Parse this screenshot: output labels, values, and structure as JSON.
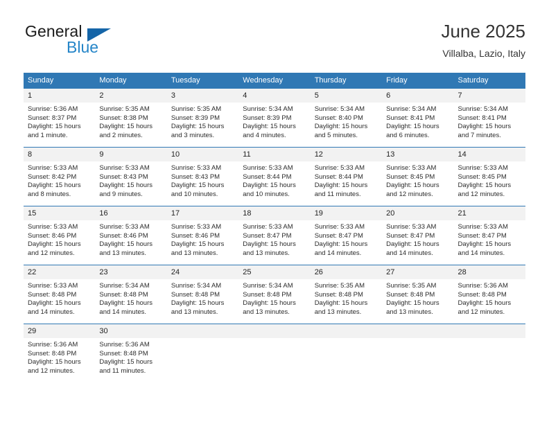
{
  "brand": {
    "name_top": "General",
    "name_bottom": "Blue",
    "accent_color": "#2585c8",
    "triangle_color": "#1565a8"
  },
  "header": {
    "title": "June 2025",
    "subtitle": "Villalba, Lazio, Italy"
  },
  "calendar": {
    "header_bg": "#3078b4",
    "daynum_bg": "#f2f2f2",
    "weekday_headers": [
      "Sunday",
      "Monday",
      "Tuesday",
      "Wednesday",
      "Thursday",
      "Friday",
      "Saturday"
    ],
    "labels": {
      "sunrise": "Sunrise:",
      "sunset": "Sunset:",
      "daylight": "Daylight:"
    },
    "weeks": [
      [
        {
          "day": "1",
          "sunrise": "Sunrise: 5:36 AM",
          "sunset": "Sunset: 8:37 PM",
          "daylight_line1": "Daylight: 15 hours",
          "daylight_line2": "and 1 minute."
        },
        {
          "day": "2",
          "sunrise": "Sunrise: 5:35 AM",
          "sunset": "Sunset: 8:38 PM",
          "daylight_line1": "Daylight: 15 hours",
          "daylight_line2": "and 2 minutes."
        },
        {
          "day": "3",
          "sunrise": "Sunrise: 5:35 AM",
          "sunset": "Sunset: 8:39 PM",
          "daylight_line1": "Daylight: 15 hours",
          "daylight_line2": "and 3 minutes."
        },
        {
          "day": "4",
          "sunrise": "Sunrise: 5:34 AM",
          "sunset": "Sunset: 8:39 PM",
          "daylight_line1": "Daylight: 15 hours",
          "daylight_line2": "and 4 minutes."
        },
        {
          "day": "5",
          "sunrise": "Sunrise: 5:34 AM",
          "sunset": "Sunset: 8:40 PM",
          "daylight_line1": "Daylight: 15 hours",
          "daylight_line2": "and 5 minutes."
        },
        {
          "day": "6",
          "sunrise": "Sunrise: 5:34 AM",
          "sunset": "Sunset: 8:41 PM",
          "daylight_line1": "Daylight: 15 hours",
          "daylight_line2": "and 6 minutes."
        },
        {
          "day": "7",
          "sunrise": "Sunrise: 5:34 AM",
          "sunset": "Sunset: 8:41 PM",
          "daylight_line1": "Daylight: 15 hours",
          "daylight_line2": "and 7 minutes."
        }
      ],
      [
        {
          "day": "8",
          "sunrise": "Sunrise: 5:33 AM",
          "sunset": "Sunset: 8:42 PM",
          "daylight_line1": "Daylight: 15 hours",
          "daylight_line2": "and 8 minutes."
        },
        {
          "day": "9",
          "sunrise": "Sunrise: 5:33 AM",
          "sunset": "Sunset: 8:43 PM",
          "daylight_line1": "Daylight: 15 hours",
          "daylight_line2": "and 9 minutes."
        },
        {
          "day": "10",
          "sunrise": "Sunrise: 5:33 AM",
          "sunset": "Sunset: 8:43 PM",
          "daylight_line1": "Daylight: 15 hours",
          "daylight_line2": "and 10 minutes."
        },
        {
          "day": "11",
          "sunrise": "Sunrise: 5:33 AM",
          "sunset": "Sunset: 8:44 PM",
          "daylight_line1": "Daylight: 15 hours",
          "daylight_line2": "and 10 minutes."
        },
        {
          "day": "12",
          "sunrise": "Sunrise: 5:33 AM",
          "sunset": "Sunset: 8:44 PM",
          "daylight_line1": "Daylight: 15 hours",
          "daylight_line2": "and 11 minutes."
        },
        {
          "day": "13",
          "sunrise": "Sunrise: 5:33 AM",
          "sunset": "Sunset: 8:45 PM",
          "daylight_line1": "Daylight: 15 hours",
          "daylight_line2": "and 12 minutes."
        },
        {
          "day": "14",
          "sunrise": "Sunrise: 5:33 AM",
          "sunset": "Sunset: 8:45 PM",
          "daylight_line1": "Daylight: 15 hours",
          "daylight_line2": "and 12 minutes."
        }
      ],
      [
        {
          "day": "15",
          "sunrise": "Sunrise: 5:33 AM",
          "sunset": "Sunset: 8:46 PM",
          "daylight_line1": "Daylight: 15 hours",
          "daylight_line2": "and 12 minutes."
        },
        {
          "day": "16",
          "sunrise": "Sunrise: 5:33 AM",
          "sunset": "Sunset: 8:46 PM",
          "daylight_line1": "Daylight: 15 hours",
          "daylight_line2": "and 13 minutes."
        },
        {
          "day": "17",
          "sunrise": "Sunrise: 5:33 AM",
          "sunset": "Sunset: 8:46 PM",
          "daylight_line1": "Daylight: 15 hours",
          "daylight_line2": "and 13 minutes."
        },
        {
          "day": "18",
          "sunrise": "Sunrise: 5:33 AM",
          "sunset": "Sunset: 8:47 PM",
          "daylight_line1": "Daylight: 15 hours",
          "daylight_line2": "and 13 minutes."
        },
        {
          "day": "19",
          "sunrise": "Sunrise: 5:33 AM",
          "sunset": "Sunset: 8:47 PM",
          "daylight_line1": "Daylight: 15 hours",
          "daylight_line2": "and 14 minutes."
        },
        {
          "day": "20",
          "sunrise": "Sunrise: 5:33 AM",
          "sunset": "Sunset: 8:47 PM",
          "daylight_line1": "Daylight: 15 hours",
          "daylight_line2": "and 14 minutes."
        },
        {
          "day": "21",
          "sunrise": "Sunrise: 5:33 AM",
          "sunset": "Sunset: 8:47 PM",
          "daylight_line1": "Daylight: 15 hours",
          "daylight_line2": "and 14 minutes."
        }
      ],
      [
        {
          "day": "22",
          "sunrise": "Sunrise: 5:33 AM",
          "sunset": "Sunset: 8:48 PM",
          "daylight_line1": "Daylight: 15 hours",
          "daylight_line2": "and 14 minutes."
        },
        {
          "day": "23",
          "sunrise": "Sunrise: 5:34 AM",
          "sunset": "Sunset: 8:48 PM",
          "daylight_line1": "Daylight: 15 hours",
          "daylight_line2": "and 14 minutes."
        },
        {
          "day": "24",
          "sunrise": "Sunrise: 5:34 AM",
          "sunset": "Sunset: 8:48 PM",
          "daylight_line1": "Daylight: 15 hours",
          "daylight_line2": "and 13 minutes."
        },
        {
          "day": "25",
          "sunrise": "Sunrise: 5:34 AM",
          "sunset": "Sunset: 8:48 PM",
          "daylight_line1": "Daylight: 15 hours",
          "daylight_line2": "and 13 minutes."
        },
        {
          "day": "26",
          "sunrise": "Sunrise: 5:35 AM",
          "sunset": "Sunset: 8:48 PM",
          "daylight_line1": "Daylight: 15 hours",
          "daylight_line2": "and 13 minutes."
        },
        {
          "day": "27",
          "sunrise": "Sunrise: 5:35 AM",
          "sunset": "Sunset: 8:48 PM",
          "daylight_line1": "Daylight: 15 hours",
          "daylight_line2": "and 13 minutes."
        },
        {
          "day": "28",
          "sunrise": "Sunrise: 5:36 AM",
          "sunset": "Sunset: 8:48 PM",
          "daylight_line1": "Daylight: 15 hours",
          "daylight_line2": "and 12 minutes."
        }
      ],
      [
        {
          "day": "29",
          "sunrise": "Sunrise: 5:36 AM",
          "sunset": "Sunset: 8:48 PM",
          "daylight_line1": "Daylight: 15 hours",
          "daylight_line2": "and 12 minutes."
        },
        {
          "day": "30",
          "sunrise": "Sunrise: 5:36 AM",
          "sunset": "Sunset: 8:48 PM",
          "daylight_line1": "Daylight: 15 hours",
          "daylight_line2": "and 11 minutes."
        },
        {
          "day": "",
          "sunrise": "",
          "sunset": "",
          "daylight_line1": "",
          "daylight_line2": "",
          "empty": true
        },
        {
          "day": "",
          "sunrise": "",
          "sunset": "",
          "daylight_line1": "",
          "daylight_line2": "",
          "empty": true
        },
        {
          "day": "",
          "sunrise": "",
          "sunset": "",
          "daylight_line1": "",
          "daylight_line2": "",
          "empty": true
        },
        {
          "day": "",
          "sunrise": "",
          "sunset": "",
          "daylight_line1": "",
          "daylight_line2": "",
          "empty": true
        },
        {
          "day": "",
          "sunrise": "",
          "sunset": "",
          "daylight_line1": "",
          "daylight_line2": "",
          "empty": true
        }
      ]
    ]
  }
}
